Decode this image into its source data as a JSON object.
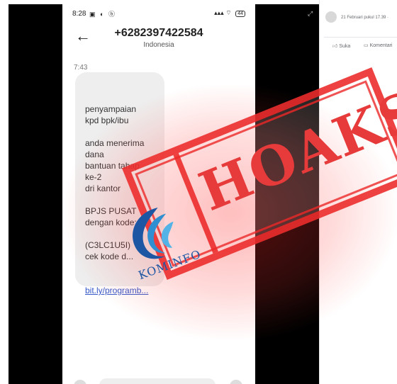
{
  "statusbar": {
    "time": "8:28",
    "left_icons": "▣ ◐ ⓑ",
    "signal": "▴▴▴",
    "battery": "44"
  },
  "conversation": {
    "phone_number": "+6282397422584",
    "country": "Indonesia",
    "message_time": "7:43",
    "message_lines": [
      "penyampaian",
      "kpd bpk/ibu",
      "",
      "anda menerima",
      "dana",
      "bantuan tahap",
      "ke-2",
      "dri kantor",
      "",
      "BPJS PUSAT",
      "dengan kode:",
      "",
      "(C3LC1U5I)",
      "cek kode d..."
    ],
    "message_link": "bit.ly/programb..."
  },
  "facebook": {
    "date": "21 Februari pukul 17.39 · ",
    "like_label": "Suka",
    "comment_label": "Komentari"
  },
  "overlay": {
    "stamp_text": "HOAKS",
    "logo_text": "KOMINFO",
    "stamp_color": "#e73b3b",
    "logo_color": "#1d56a3"
  },
  "icons": [
    "back-arrow-icon",
    "battery-icon",
    "wifi-icon",
    "expand-icon",
    "like-icon",
    "comment-icon",
    "kominfo-logo"
  ]
}
